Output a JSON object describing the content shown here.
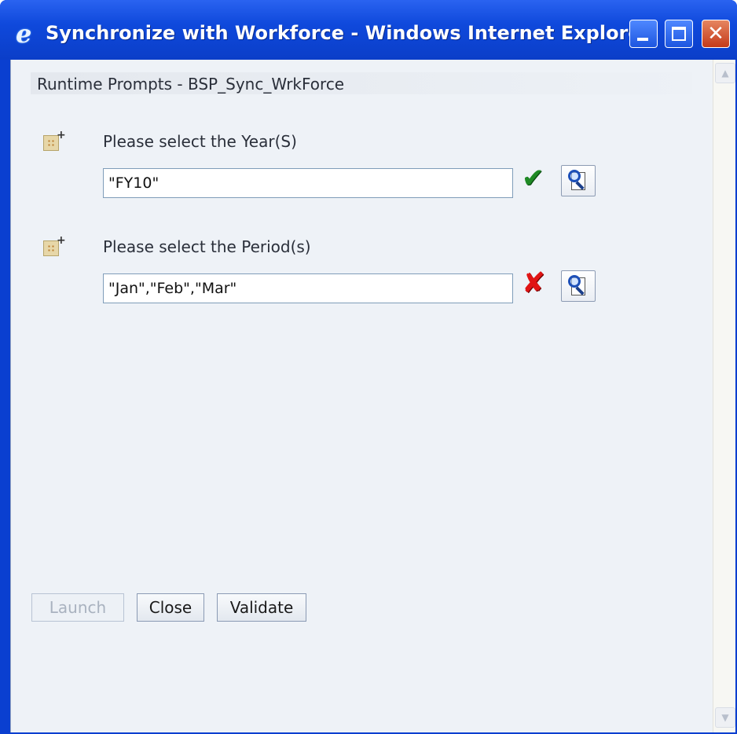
{
  "window": {
    "title": "Synchronize with Workforce - Windows Internet Explorer",
    "app_icon": "internet-explorer-icon",
    "controls": {
      "minimize": "minimize-icon",
      "maximize": "maximize-icon",
      "close": "close-icon",
      "close_glyph": "✕"
    }
  },
  "header": {
    "title": "Runtime Prompts - BSP_Sync_WrkForce"
  },
  "prompts": [
    {
      "label": "Please select the Year(S)",
      "value": "\"FY10\"",
      "status": "valid",
      "status_glyph": "✔"
    },
    {
      "label": "Please select the Period(s)",
      "value": "\"Jan\",\"Feb\",\"Mar\"",
      "status": "invalid",
      "status_glyph": "✘"
    }
  ],
  "buttons": {
    "launch": "Launch",
    "close": "Close",
    "validate": "Validate"
  },
  "colors": {
    "title_bar": "#0b3ec8",
    "client_bg": "#eef2f7",
    "valid": "#1f8a25",
    "invalid": "#e01414"
  }
}
